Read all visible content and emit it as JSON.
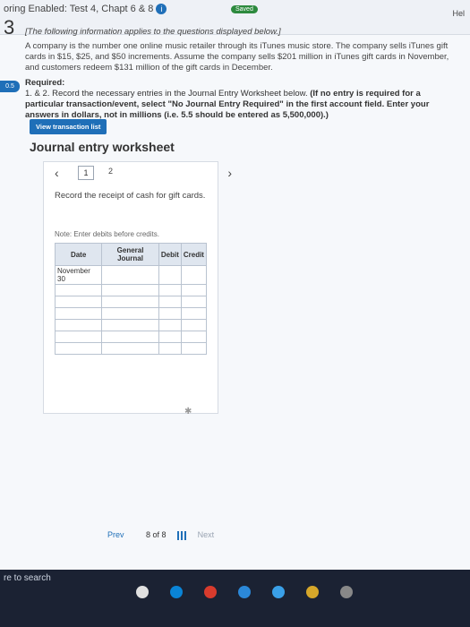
{
  "header": {
    "mode": "oring Enabled: Test 4, Chapt 6 & 8",
    "saved": "Saved",
    "help": "Hel"
  },
  "question": {
    "number": "3",
    "points": "0.5",
    "lead": "[The following information applies to the questions displayed below.]",
    "body": "A company is the number one online music retailer through its iTunes music store. The company sells iTunes gift cards in $15, $25, and $50 increments. Assume the company sells $201 million in iTunes gift cards in November, and customers redeem $131 million of the gift cards in December."
  },
  "required": {
    "heading": "Required:",
    "line1": "1. & 2. Record the necessary entries in the Journal Entry Worksheet below. ",
    "bold": "(If no entry is required for a particular transaction/event, select \"No Journal Entry Required\" in the first account field. Enter your answers in dollars, not in millions (i.e. 5.5 should be entered as 5,500,000).)"
  },
  "buttons": {
    "view_transaction_list": "View transaction list"
  },
  "worksheet": {
    "title": "Journal entry worksheet",
    "pages": [
      "1",
      "2"
    ],
    "instruction": "Record the receipt of cash for gift cards.",
    "note": "Note: Enter debits before credits.",
    "columns": [
      "Date",
      "General Journal",
      "Debit",
      "Credit"
    ],
    "first_date": "November 30"
  },
  "pager": {
    "prev": "Prev",
    "position": "8 of 8",
    "next": "Next"
  },
  "taskbar": {
    "search": "re to search"
  }
}
